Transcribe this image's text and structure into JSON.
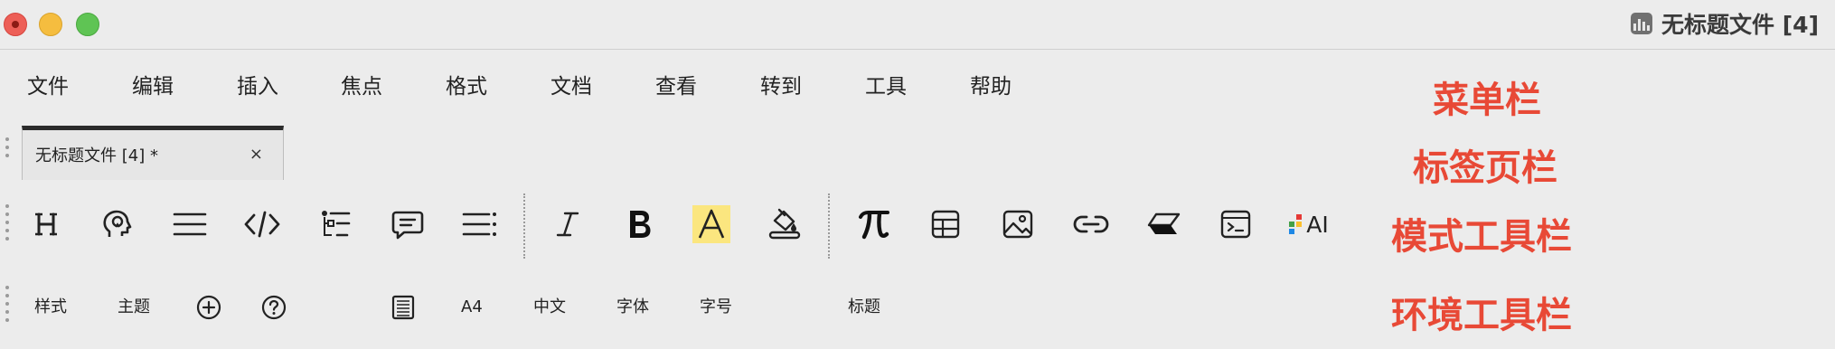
{
  "window": {
    "title": "无标题文件 [4]",
    "app_icon": "chart-bars-icon"
  },
  "menu": {
    "items": [
      "文件",
      "编辑",
      "插入",
      "焦点",
      "格式",
      "文档",
      "查看",
      "转到",
      "工具",
      "帮助"
    ]
  },
  "annotations": {
    "menu_bar": "菜单栏",
    "tab_bar": "标签页栏",
    "mode_toolbar": "模式工具栏",
    "env_toolbar": "环境工具栏",
    "color": "#e84936"
  },
  "tabs": [
    {
      "label": "无标题文件 [4] *",
      "close": "×"
    }
  ],
  "mode_toolbar": {
    "icons": [
      "heading-icon",
      "lightbulb-head-icon",
      "align-lines-icon",
      "code-icon",
      "outline-tree-icon",
      "comment-icon",
      "list-icon",
      "italic-icon",
      "bold-icon",
      "highlight-icon",
      "paint-bucket-icon",
      "pi-formula-icon",
      "table-icon",
      "image-icon",
      "link-icon",
      "eraser-icon",
      "terminal-icon",
      "ai-icon"
    ],
    "ai_label": "AI",
    "highlight_color": "#fbe67f"
  },
  "env_toolbar": {
    "style": "样式",
    "theme": "主题",
    "add_icon": "plus-circle-icon",
    "help_icon": "question-circle-icon",
    "doc_icon": "document-lines-icon",
    "paper": "A4",
    "language": "中文",
    "font": "字体",
    "font_size": "字号",
    "heading": "标题"
  }
}
